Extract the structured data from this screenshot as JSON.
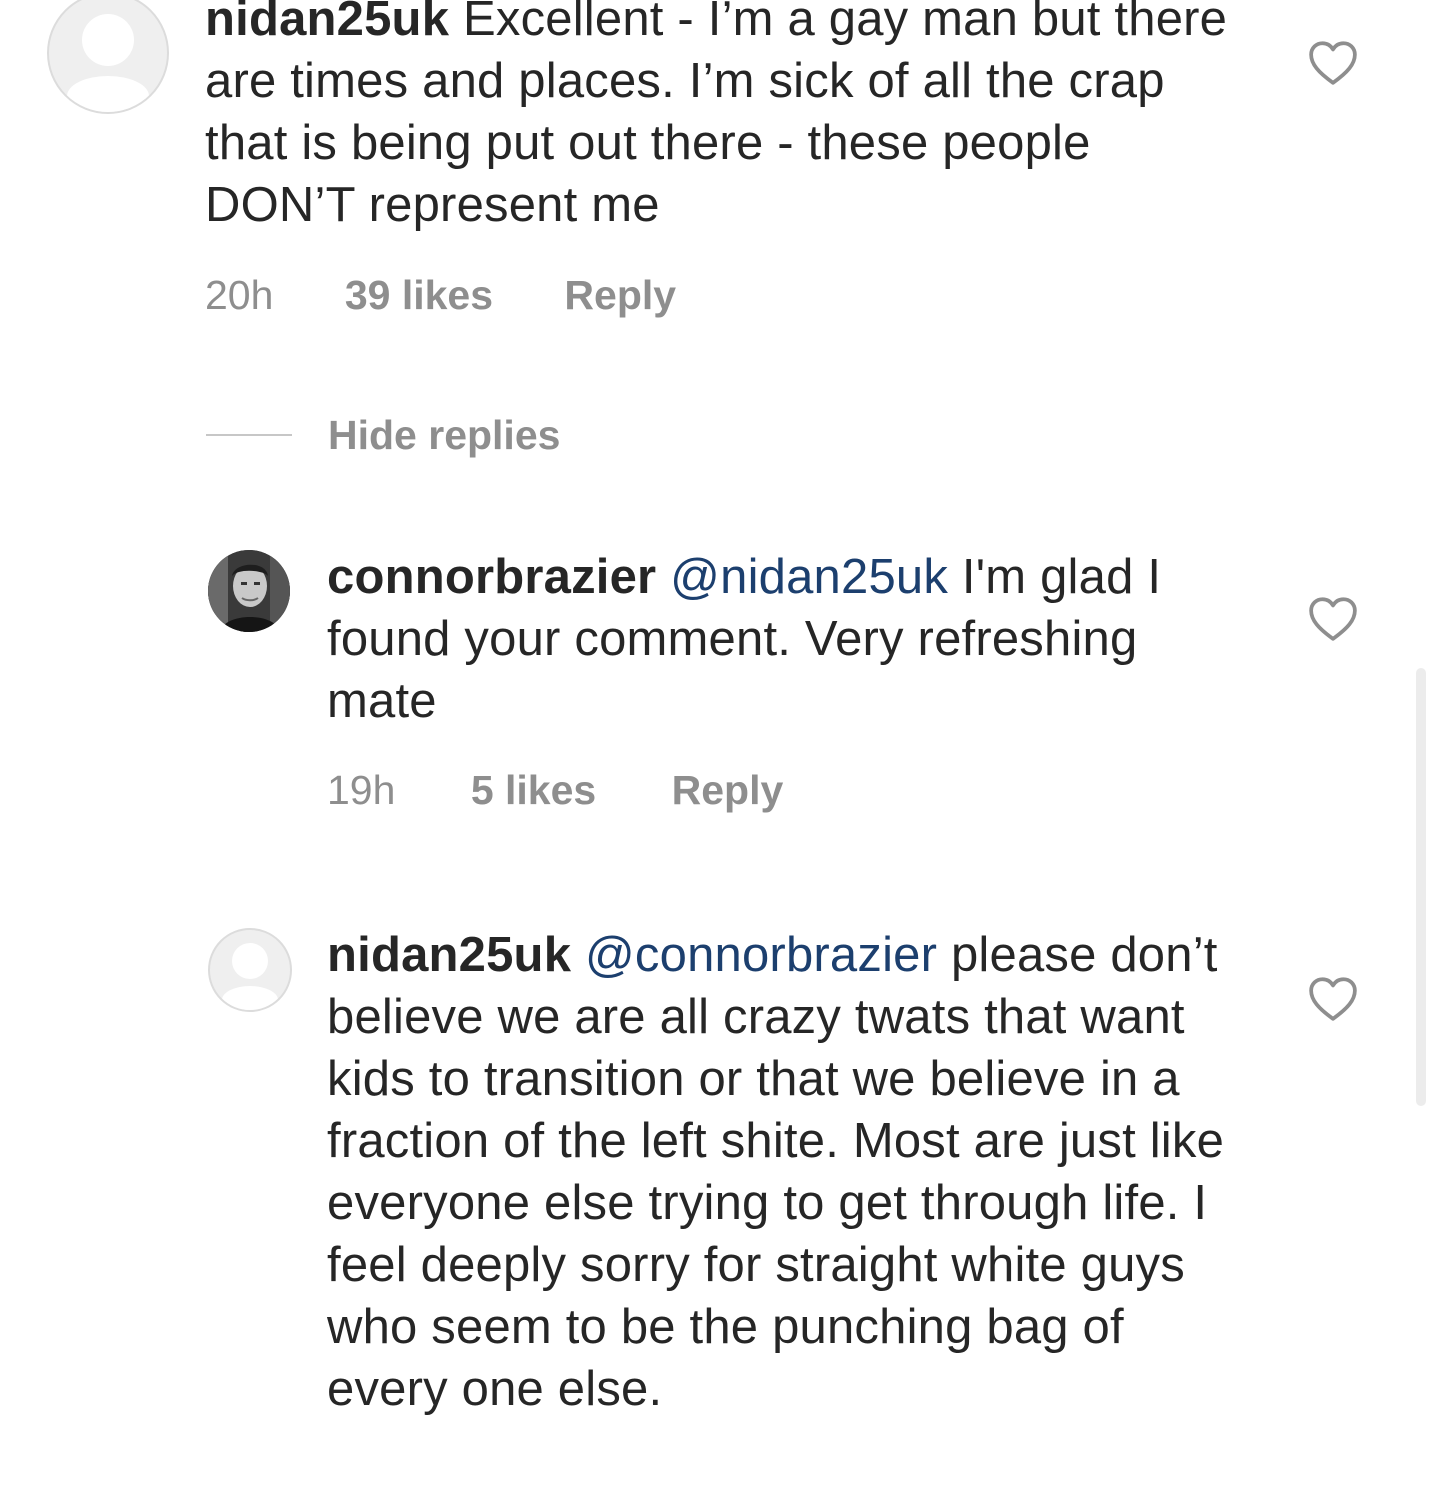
{
  "comments": [
    {
      "username": "nidan25uk",
      "mention": "",
      "text": "Excellent - I’m a gay man but there are times and places. I’m sick of all the crap that is being put out there - these people DON’T represent me",
      "time": "20h",
      "likes": "39 likes",
      "reply": "Reply",
      "avatar": "placeholder-avatar-icon"
    },
    {
      "username": "connorbrazier",
      "mention": "@nidan25uk",
      "text": "I'm glad I found your comment. Very refreshing mate",
      "time": "19h",
      "likes": "5 likes",
      "reply": "Reply",
      "avatar": "profile-photo"
    },
    {
      "username": "nidan25uk",
      "mention": "@connorbrazier",
      "text": "please don’t believe we are all crazy twats that want kids to transition or that we believe in a fraction of the left shite. Most are just like everyone else trying to get through life. I feel deeply sorry for straight white guys who seem to be the punching bag of every one else.",
      "time": "",
      "likes": "",
      "reply": "",
      "avatar": "placeholder-avatar-icon"
    }
  ],
  "thread": {
    "hide_replies_label": "Hide replies"
  },
  "colors": {
    "text": "#262626",
    "meta": "#8e8e8e",
    "mention": "#1c3f6e",
    "background": "#ffffff"
  },
  "icons": {
    "like": "heart-icon"
  }
}
